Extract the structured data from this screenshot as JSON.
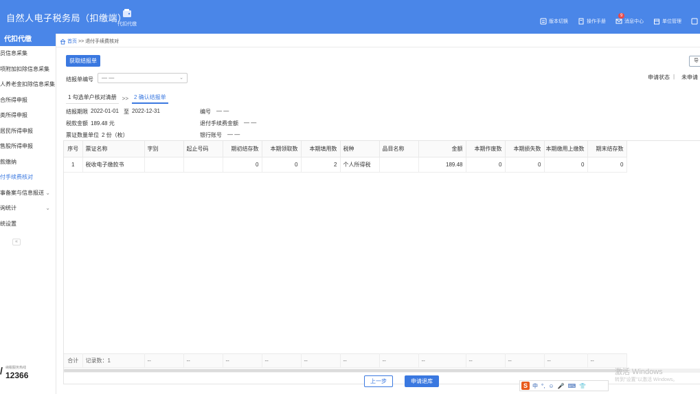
{
  "header": {
    "app_title": "自然人电子税务局（扣缴端）",
    "module_label": "代扣代缴",
    "actions": [
      {
        "label": "版本切换",
        "icon": "version-icon"
      },
      {
        "label": "操作手册",
        "icon": "manual-icon"
      },
      {
        "label": "消息中心",
        "icon": "message-icon",
        "badge": "9"
      },
      {
        "label": "单位管理",
        "icon": "unit-icon"
      },
      {
        "label": "",
        "icon": "refresh-icon"
      }
    ]
  },
  "sidebar": {
    "title": "代扣代缴",
    "items": [
      {
        "label": "员信息采集"
      },
      {
        "label": "项附加扣除信息采集"
      },
      {
        "label": "人养老金扣除信息采集"
      },
      {
        "label": "合所得申报"
      },
      {
        "label": "类所得申报"
      },
      {
        "label": "居民所得申报"
      },
      {
        "label": "售股所得申报"
      },
      {
        "label": "款缴纳"
      },
      {
        "label": "付手续费核对",
        "active": true
      },
      {
        "label": "事备案与信息报送",
        "has_children": true
      },
      {
        "label": "询统计",
        "has_children": true
      },
      {
        "label": "统设置"
      }
    ],
    "collapse_label": "«",
    "hotline_label": "纳税服务热线",
    "hotline_number": "12366"
  },
  "breadcrumb": {
    "home": "首页",
    "separator": ">>",
    "current": "退付手续费核对"
  },
  "toolbar": {
    "fetch_button": "获取结报单",
    "export_button": "导"
  },
  "filter": {
    "label": "结报单编号",
    "select_value": "— —",
    "status_label": "申请状态",
    "status_sep": "|",
    "status_value": "未申请"
  },
  "steps": [
    {
      "label": "1 勾选单户核对清册",
      "active": false
    },
    {
      "label": "2 确认结报单",
      "active": true
    }
  ],
  "step_separator": ">>",
  "summary": {
    "period_label": "结报期限",
    "period_start": "2022-01-01",
    "period_to": "至",
    "period_end": "2022-12-31",
    "code_label": "编号",
    "code_value": "— —",
    "tax_label": "税款金额",
    "tax_value": "189.48 元",
    "refund_label": "退付手续费金额",
    "refund_value": "— —",
    "count_label": "票证数量单位",
    "count_value": "2 份（枚）",
    "bank_label": "银行账号",
    "bank_value": "— —"
  },
  "table": {
    "columns": [
      "序号",
      "票证名称",
      "字别",
      "起止号码",
      "期初结存数",
      "本期领取数",
      "本期填用数",
      "税种",
      "品目名称",
      "金额",
      "本期作废数",
      "本期损失数",
      "本期缴用上缴数",
      "期末结存数"
    ],
    "rows": [
      [
        "1",
        "税收电子缴款书",
        "",
        "",
        "0",
        "0",
        "2",
        "个人所得税",
        "",
        "189.48",
        "0",
        "0",
        "0",
        "0"
      ]
    ],
    "footer": [
      "合计",
      "记录数：1",
      "--",
      "--",
      "--",
      "--",
      "--",
      "--",
      "--",
      "--",
      "--",
      "--",
      "--",
      "--"
    ]
  },
  "buttons": {
    "prev": "上一步",
    "apply": "申请退库"
  },
  "ime": {
    "logo": "S",
    "items": [
      "中",
      "°,",
      "☺",
      "🎤",
      "⌨",
      "👕"
    ]
  },
  "watermark": {
    "line1": "激活 Windows",
    "line2": "转到\"设置\"以激活 Windows。"
  }
}
